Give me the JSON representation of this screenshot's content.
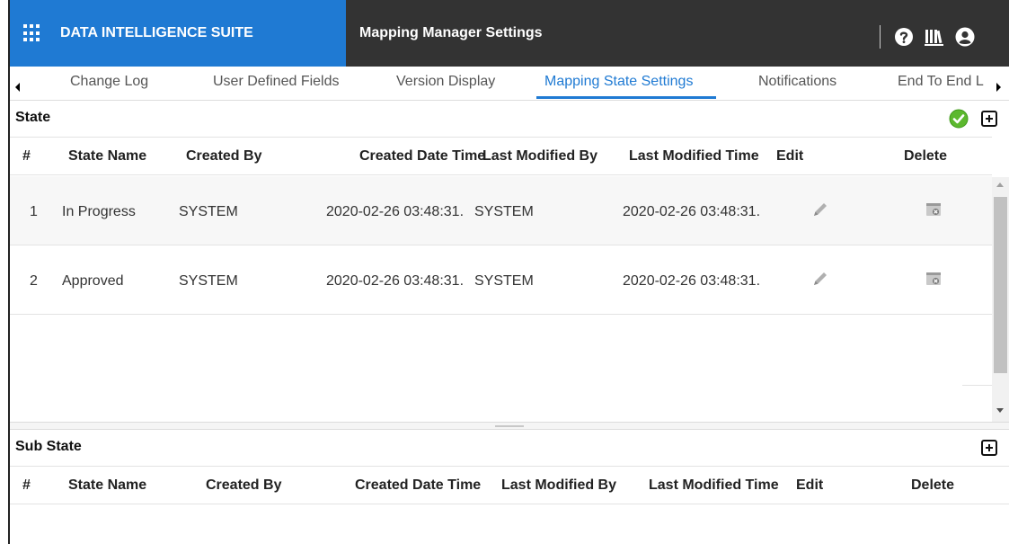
{
  "topbar": {
    "brand": "DATA INTELLIGENCE SUITE",
    "title": "Mapping Manager Settings",
    "brand_color": "#1f7ad3",
    "bar_color": "#333333",
    "icons": [
      "apps-grid-icon",
      "help-icon",
      "library-icon",
      "user-account-icon"
    ]
  },
  "tabs": [
    {
      "label": "Change Log"
    },
    {
      "label": "User Defined Fields"
    },
    {
      "label": "Version Display"
    },
    {
      "label": "Mapping State Settings",
      "active": true
    },
    {
      "label": "Notifications"
    },
    {
      "label": "End To End L"
    }
  ],
  "state_section": {
    "title": "State",
    "columns": [
      "#",
      "State Name",
      "Created By",
      "Created Date Time",
      "Last Modified By",
      "Last Modified Time",
      "Edit",
      "Delete"
    ],
    "rows": [
      {
        "num": "1",
        "state_name": "In Progress",
        "created_by": "SYSTEM",
        "created_date_time": "2020-02-26 03:48:31.",
        "last_modified_by": "SYSTEM",
        "last_modified_time": "2020-02-26 03:48:31."
      },
      {
        "num": "2",
        "state_name": "Approved",
        "created_by": "SYSTEM",
        "created_date_time": "2020-02-26 03:48:31.",
        "last_modified_by": "SYSTEM",
        "last_modified_time": "2020-02-26 03:48:31."
      }
    ]
  },
  "sub_state_section": {
    "title": "Sub State",
    "columns": [
      "#",
      "State Name",
      "Created By",
      "Created Date Time",
      "Last Modified By",
      "Last Modified Time",
      "Edit",
      "Delete"
    ]
  }
}
